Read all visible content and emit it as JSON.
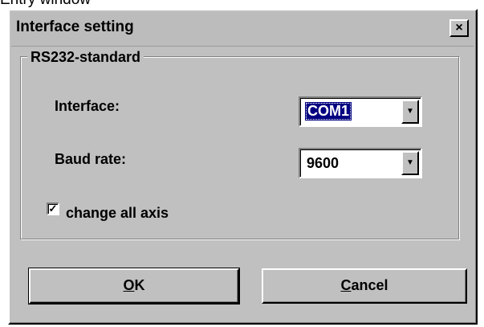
{
  "caption": "Entry window",
  "dialog": {
    "title": "Interface setting",
    "close_glyph": "×"
  },
  "group": {
    "label": "RS232-standard",
    "interface_label": "Interface:",
    "interface_value": "COM1",
    "baud_label": "Baud rate:",
    "baud_value": "9600",
    "checkbox_label": "change all axis",
    "checkbox_checked": true
  },
  "buttons": {
    "ok_mnemonic": "O",
    "ok_rest": "K",
    "cancel_mnemonic": "C",
    "cancel_rest": "ancel"
  },
  "icons": {
    "dropdown_arrow": "▼",
    "check_mark": "✓"
  }
}
